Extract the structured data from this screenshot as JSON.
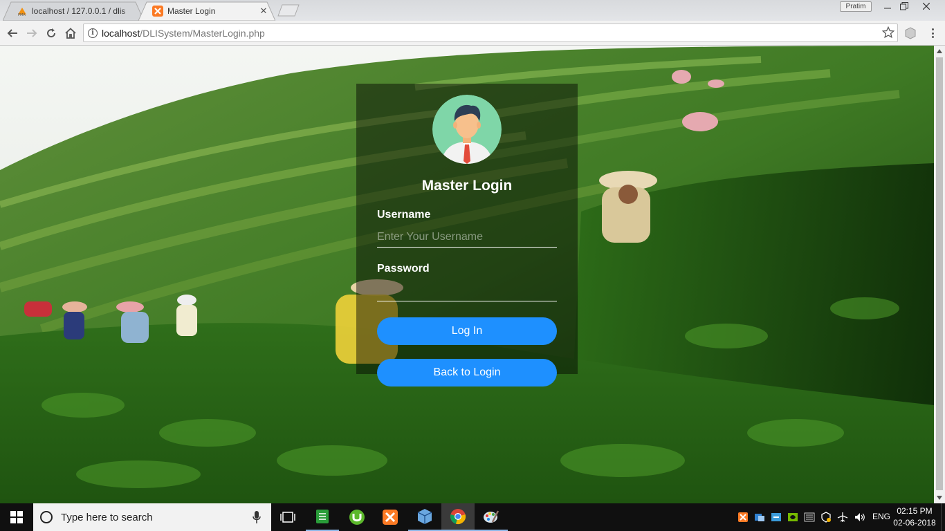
{
  "browser": {
    "tabs": [
      {
        "label": "localhost / 127.0.0.1 / dlis",
        "active": false
      },
      {
        "label": "Master Login",
        "active": true
      }
    ],
    "profile_name": "Pratim",
    "url_host": "localhost",
    "url_path": "/DLISystem/MasterLogin.php"
  },
  "login": {
    "title": "Master Login",
    "username_label": "Username",
    "username_placeholder": "Enter Your Username",
    "username_value": "",
    "password_label": "Password",
    "password_value": "",
    "login_button": "Log In",
    "back_button": "Back to Login"
  },
  "taskbar": {
    "search_placeholder": "Type here to search",
    "apps": [
      "task-view-icon",
      "notepad-icon",
      "utorrent-icon",
      "xampp-icon",
      "virtualbox-icon",
      "chrome-icon",
      "paint-icon"
    ],
    "language": "ENG",
    "time": "02:15 PM",
    "date": "02-06-2018"
  },
  "colors": {
    "accent": "#1e90ff",
    "card_overlay": "rgba(0,0,0,0.45)",
    "avatar_bg": "#7fd6a8"
  }
}
